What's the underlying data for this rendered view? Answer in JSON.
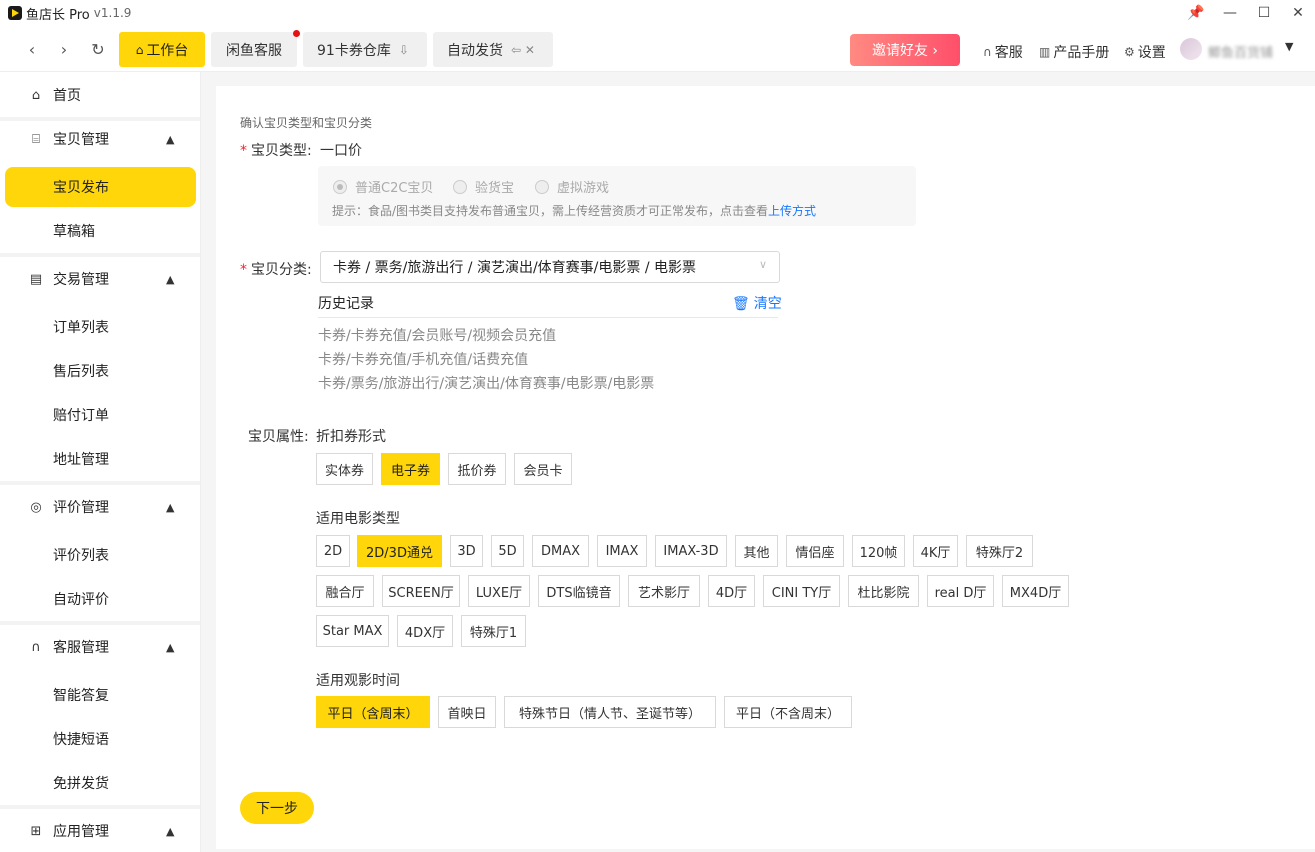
{
  "window": {
    "title": "鱼店长 Pro",
    "version": "v1.1.9",
    "controls": [
      "📌",
      "—",
      "☐",
      "✕"
    ]
  },
  "tabs": [
    {
      "label": "工作台",
      "icon": "home-icon"
    },
    {
      "label": "闲鱼客服",
      "badge": "red-dot"
    },
    {
      "label": "91卡券仓库",
      "tail": "⇩"
    },
    {
      "label": "自动发货",
      "tail": "⇦ ✕"
    }
  ],
  "topbar": {
    "invite": "邀请好友 ›",
    "service": "客服",
    "manual": "产品手册",
    "settings": "设置",
    "username": "鲫鱼百货铺"
  },
  "sidebar": {
    "home": "首页",
    "g1": "宝贝管理",
    "g1_items": [
      "宝贝发布",
      "草稿箱"
    ],
    "g2": "交易管理",
    "g2_items": [
      "订单列表",
      "售后列表",
      "赔付订单",
      "地址管理"
    ],
    "g3": "评价管理",
    "g3_items": [
      "评价列表",
      "自动评价"
    ],
    "g4": "客服管理",
    "g4_items": [
      "智能答复",
      "快捷短语",
      "免拼发货"
    ],
    "g5": "应用管理"
  },
  "form": {
    "section_hint": "确认宝贝类型和宝贝分类",
    "type_label": "宝贝类型:",
    "type_value": "一口价",
    "radios": [
      "普通C2C宝贝",
      "验货宝",
      "虚拟游戏"
    ],
    "type_tip": "提示：食品/图书类目支持发布普通宝贝，需上传经营资质才可正常发布，点击查看",
    "type_tip_link": "上传方式",
    "category_label": "宝贝分类:",
    "category_value": "卡券 / 票务/旅游出行 / 演艺演出/体育赛事/电影票 / 电影票",
    "history_title": "历史记录",
    "history_clear": "清空",
    "history": [
      "卡券/卡券充值/会员账号/视频会员充值",
      "卡券/卡券充值/手机充值/话费充值",
      "卡券/票务/旅游出行/演艺演出/体育赛事/电影票/电影票"
    ],
    "attr_label": "宝贝属性:",
    "coupon_form_title": "折扣券形式",
    "coupon_forms": [
      "实体券",
      "电子券",
      "抵价券",
      "会员卡"
    ],
    "movie_type_title": "适用电影类型",
    "movie_types_row1": [
      "2D",
      "2D/3D通兑",
      "3D",
      "5D",
      "DMAX",
      "IMAX",
      "IMAX-3D",
      "其他",
      "情侣座",
      "120帧",
      "4K厅",
      "特殊厅2"
    ],
    "movie_types_row2": [
      "融合厅",
      "SCREEN厅",
      "LUXE厅",
      "DTS临镜音",
      "艺术影厅",
      "4D厅",
      "CINI TY厅",
      "杜比影院",
      "real D厅",
      "MX4D厅"
    ],
    "movie_types_row3": [
      "Star MAX",
      "4DX厅",
      "特殊厅1"
    ],
    "time_title": "适用观影时间",
    "times": [
      "平日（含周末）",
      "首映日",
      "特殊节日（情人节、圣诞节等）",
      "平日（不含周末）"
    ],
    "next": "下一步"
  }
}
